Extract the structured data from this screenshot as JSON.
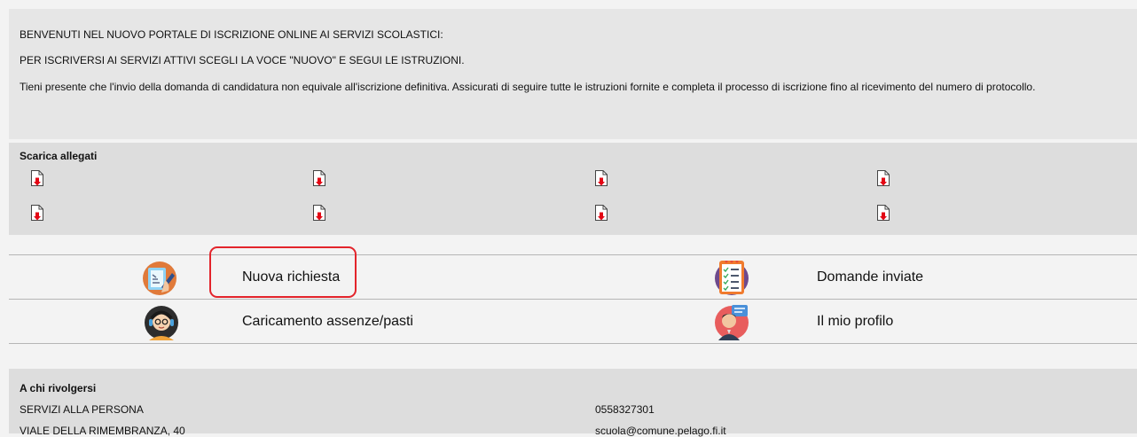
{
  "welcome": {
    "line1": "BENVENUTI NEL NUOVO PORTALE DI ISCRIZIONE ONLINE AI SERVIZI SCOLASTICI:",
    "line2": "PER ISCRIVERSI AI SERVIZI ATTIVI SCEGLI LA VOCE \"NUOVO\" E SEGUI LE ISTRUZIONI.",
    "line3": "Tieni presente che l'invio della domanda di candidatura non equivale all'iscrizione definitiva. Assicurati di seguire tutte le istruzioni fornite e completa il processo di iscrizione fino al ricevimento del numero di protocollo."
  },
  "attachments": {
    "title": "Scarica allegati",
    "icon": "pdf-download-icon",
    "count": 8
  },
  "menu": {
    "new_request": {
      "label": "Nuova richiesta",
      "icon": "new-request-icon"
    },
    "sent_applications": {
      "label": "Domande inviate",
      "icon": "checklist-icon"
    },
    "absences": {
      "label": "Caricamento assenze/pasti",
      "icon": "operator-icon"
    },
    "profile": {
      "label": "Il mio profilo",
      "icon": "profile-icon"
    }
  },
  "contacts": {
    "title": "A chi rivolgersi",
    "office": "SERVIZI ALLA PERSONA",
    "address": "VIALE DELLA RIMEMBRANZA, 40",
    "phone": "0558327301",
    "email": "scuola@comune.pelago.fi.it"
  },
  "colors": {
    "highlight": "#e3242b",
    "download_arrow": "#e30613"
  }
}
